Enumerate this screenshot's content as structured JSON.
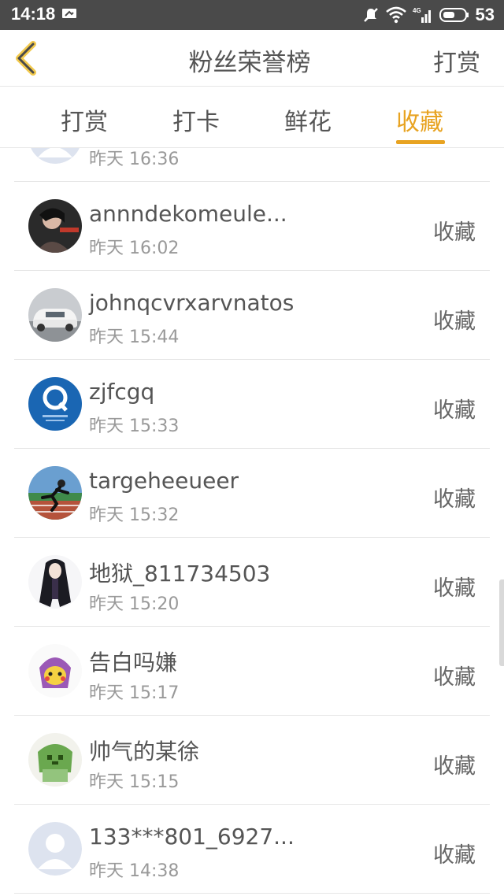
{
  "status_bar": {
    "time": "14:18",
    "network": "4G",
    "battery": "53"
  },
  "header": {
    "title": "粉丝荣誉榜",
    "action_label": "打赏",
    "accent_color": "#e8a321"
  },
  "tabs": [
    {
      "label": "打赏",
      "active": false
    },
    {
      "label": "打卡",
      "active": false
    },
    {
      "label": "鲜花",
      "active": false
    },
    {
      "label": "收藏",
      "active": true
    }
  ],
  "rows": [
    {
      "name": "",
      "time": "昨天 16:36",
      "action": "",
      "avatar_icon": "default-avatar-icon"
    },
    {
      "name": "annndekomeule...",
      "time": "昨天 16:02",
      "action": "收藏",
      "avatar_icon": "photo-avatar-icon"
    },
    {
      "name": "johnqcvrxarvnatos",
      "time": "昨天 15:44",
      "action": "收藏",
      "avatar_icon": "car-avatar-icon"
    },
    {
      "name": "zjfcgq",
      "time": "昨天 15:33",
      "action": "收藏",
      "avatar_icon": "q-logo-avatar-icon"
    },
    {
      "name": "targeheeueer",
      "time": "昨天 15:32",
      "action": "收藏",
      "avatar_icon": "runner-avatar-icon"
    },
    {
      "name": "地狱_811734503",
      "time": "昨天 15:20",
      "action": "收藏",
      "avatar_icon": "anime-girl-avatar-icon"
    },
    {
      "name": "告白吗嫌",
      "time": "昨天 15:17",
      "action": "收藏",
      "avatar_icon": "pikachu-avatar-icon"
    },
    {
      "name": "帅气的某徐",
      "time": "昨天 15:15",
      "action": "收藏",
      "avatar_icon": "green-character-avatar-icon"
    },
    {
      "name": "133***801_6927...",
      "time": "昨天 14:38",
      "action": "收藏",
      "avatar_icon": "default-avatar-icon"
    }
  ]
}
